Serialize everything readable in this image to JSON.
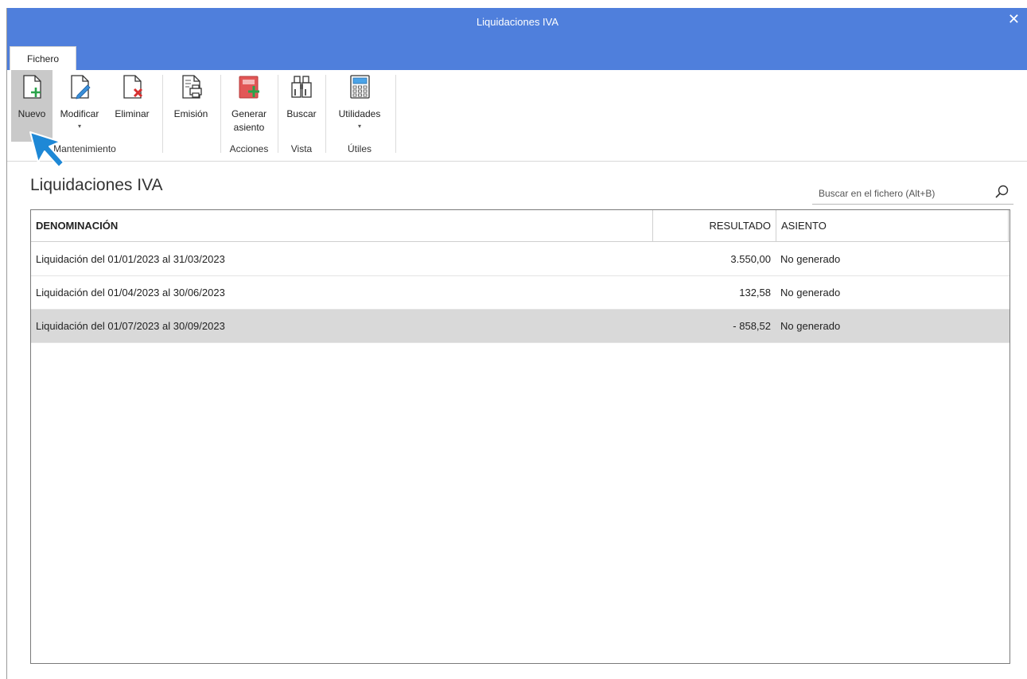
{
  "window": {
    "title": "Liquidaciones IVA",
    "close_glyph": "✕"
  },
  "tabs": [
    {
      "label": "Fichero"
    }
  ],
  "ribbon": {
    "buttons": {
      "nuevo": {
        "label": "Nuevo",
        "icon": "new-document-icon"
      },
      "modificar": {
        "label": "Modificar",
        "icon": "edit-document-icon",
        "drop": "▾"
      },
      "eliminar": {
        "label": "Eliminar",
        "icon": "delete-document-icon"
      },
      "emision": {
        "label": "Emisión",
        "icon": "print-document-icon"
      },
      "generar_line1": "Generar",
      "generar_line2": "asiento",
      "buscar": {
        "label": "Buscar",
        "icon": "binoculars-icon"
      },
      "utilidades": {
        "label": "Utilidades",
        "icon": "calculator-icon",
        "drop": "▾"
      }
    },
    "groups": {
      "mantenimiento": "Mantenimiento",
      "acciones": "Acciones",
      "vista": "Vista",
      "utiles": "Útiles"
    }
  },
  "main": {
    "heading": "Liquidaciones IVA",
    "search": {
      "placeholder": "Buscar en el fichero (Alt+B)"
    }
  },
  "table": {
    "columns": {
      "denominacion": "DENOMINACIÓN",
      "resultado": "RESULTADO",
      "asiento": "ASIENTO"
    },
    "rows": [
      {
        "denominacion": "Liquidación del 01/01/2023 al 31/03/2023",
        "resultado": "3.550,00",
        "asiento": "No generado"
      },
      {
        "denominacion": "Liquidación del 01/04/2023 al 30/06/2023",
        "resultado": "132,58",
        "asiento": "No generado"
      },
      {
        "denominacion": "Liquidación del 01/07/2023 al 30/09/2023",
        "resultado": "- 858,52",
        "asiento": "No generado"
      }
    ]
  },
  "colors": {
    "titlebar": "#4f7fdc",
    "selected_row": "#d9d9d9",
    "pointer": "#1e88d6"
  }
}
